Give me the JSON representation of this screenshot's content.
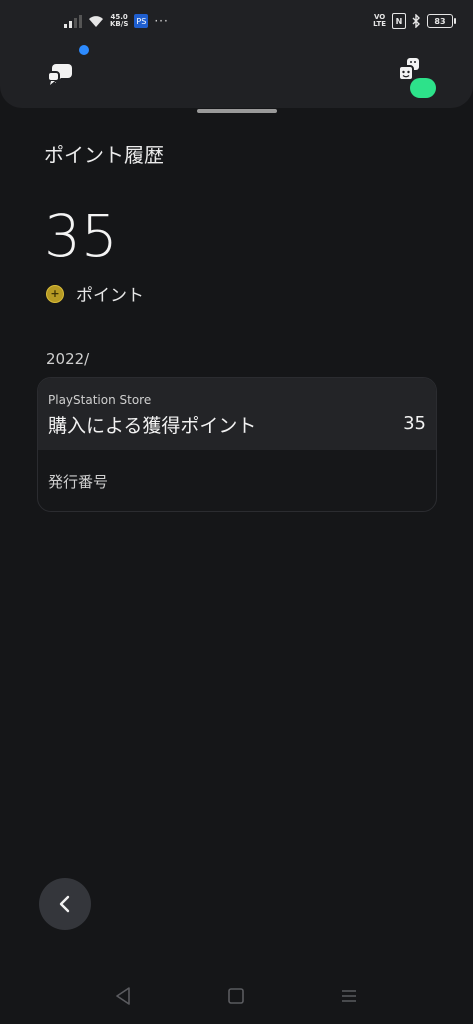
{
  "status_bar": {
    "speed_value": "45.0",
    "speed_unit": "KB/S",
    "ps_badge": "PS",
    "more": "···",
    "volte_top": "VO",
    "volte_bottom": "LTE",
    "nfc": "N",
    "battery": "83"
  },
  "header": {
    "icons": [
      "chat-bubbles-icon",
      "avatar-icon"
    ],
    "notification_color": "#2d8bff",
    "online_color": "#2de28a"
  },
  "page": {
    "title": "ポイント履歴",
    "points_total": "35",
    "points_unit": "ポイント"
  },
  "history": {
    "date": "2022/",
    "entries": [
      {
        "source": "PlayStation Store",
        "description": "購入による獲得ポイント",
        "amount": "35",
        "id_label": "発行番号"
      }
    ]
  },
  "navigation": {
    "back_icon": "chevron-left-icon",
    "system_buttons": [
      "back-triangle-icon",
      "home-square-icon",
      "menu-lines-icon"
    ]
  }
}
